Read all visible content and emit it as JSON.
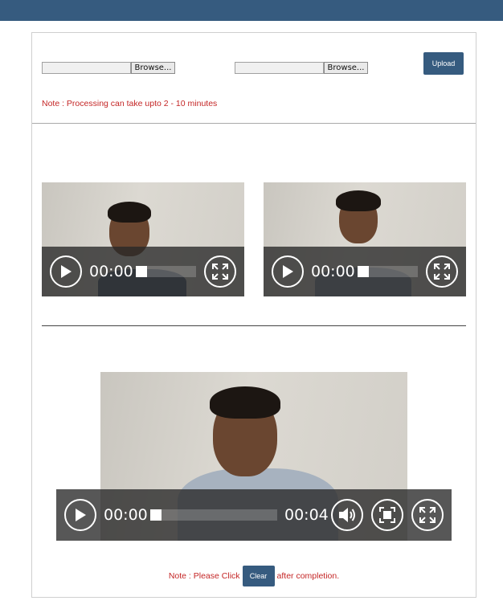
{
  "upload": {
    "file_inputs": [
      {
        "browse_label": "Browse..."
      },
      {
        "browse_label": "Browse..."
      }
    ],
    "upload_label": "Upload",
    "note": "Note : Processing can take upto 2 - 10 minutes"
  },
  "videos": [
    {
      "current_time": "00:00",
      "progress": 0
    },
    {
      "current_time": "00:00",
      "progress": 0
    }
  ],
  "result_video": {
    "current_time": "00:00",
    "duration": "00:04",
    "progress": 0
  },
  "footer": {
    "note_before": "Note : Please Click",
    "clear_label": "Clear",
    "note_after": "after completion."
  },
  "colors": {
    "brand": "#365b7f",
    "note_text": "#c42626"
  },
  "icons": [
    "play-icon",
    "fullscreen-icon",
    "volume-icon",
    "fit-screen-icon"
  ]
}
